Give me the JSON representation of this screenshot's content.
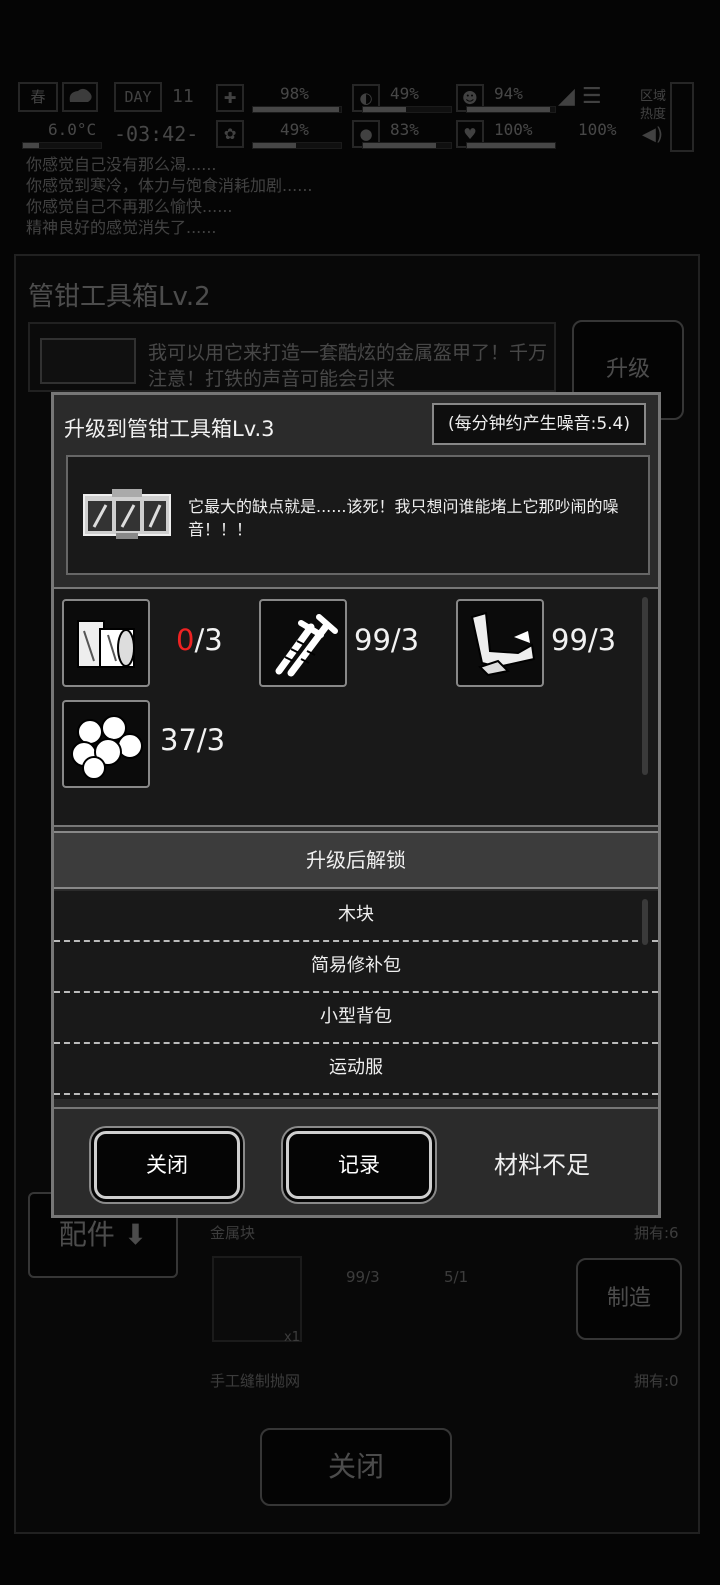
{
  "hud": {
    "season": "春",
    "day_label": "DAY",
    "day_number": "11",
    "temperature": "6.0°C",
    "clock": "-03:42-",
    "stats_top": [
      {
        "value": "98%",
        "icon": "first-aid-icon",
        "level": 0.98
      },
      {
        "value": "49%",
        "icon": "stomach-icon",
        "level": 0.49
      },
      {
        "value": "94%",
        "icon": "stamina-icon",
        "level": 0.94
      }
    ],
    "stats_bottom": [
      {
        "value": "49%",
        "icon": "brain-icon",
        "level": 0.49
      },
      {
        "value": "83%",
        "icon": "water-drop-icon",
        "level": 0.83
      },
      {
        "value": "100%",
        "icon": "heart-icon",
        "level": 1.0
      }
    ],
    "equipment_percent": "100%",
    "area_label_1": "区域",
    "area_label_2": "热度"
  },
  "log": {
    "lines": [
      "你感觉自己没有那么渴......",
      "你感觉到寒冷，体力与饱食消耗加剧......",
      "你感觉自己不再那么愉快......",
      "精神良好的感觉消失了......"
    ]
  },
  "panel": {
    "title": "管钳工具箱Lv.2",
    "desc": "我可以用它来打造一套酷炫的金属盔甲了！千万注意！打铁的声音可能会引来",
    "upgrade_label": "升级",
    "parts_label": "配件",
    "recipe_name": "金属块",
    "recipe_owned": "拥有:6",
    "recipe_mat1": "99/3",
    "recipe_mat2": "5/1",
    "recipe_qty": "x1",
    "craft_label": "制造",
    "next_recipe_name": "手工缝制抛网",
    "next_recipe_owned": "拥有:0",
    "close_label": "关闭"
  },
  "modal": {
    "title": "升级到管钳工具箱Lv.3",
    "noise": "(每分钟约产生噪音:5.4)",
    "description": "它最大的缺点就是......该死！我只想问谁能堵上它那吵闹的噪音！！！",
    "materials": [
      {
        "icon": "wood-planks-icon",
        "have": "0",
        "need": "/3",
        "sufficient": false
      },
      {
        "icon": "screws-icon",
        "have": "99",
        "need": "/3",
        "sufficient": true
      },
      {
        "icon": "scrap-metal-icon",
        "have": "99",
        "need": "/3",
        "sufficient": true
      },
      {
        "icon": "cotton-balls-icon",
        "have": "37",
        "need": "/3",
        "sufficient": true
      }
    ],
    "unlock_header": "升级后解锁",
    "unlocks": [
      "木块",
      "简易修补包",
      "小型背包",
      "运动服"
    ],
    "buttons": {
      "close": "关闭",
      "record": "记录"
    },
    "status": "材料不足"
  },
  "colors": {
    "insufficient": "#e22222",
    "modal_bg": "#2b2b2b",
    "dark": "#191919"
  }
}
